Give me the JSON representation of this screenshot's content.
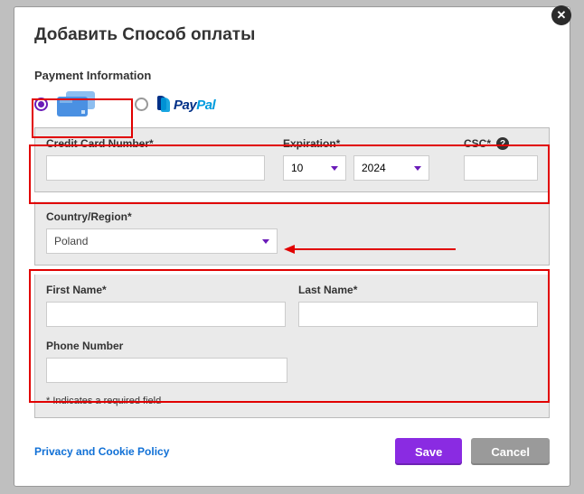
{
  "modal": {
    "title": "Добавить Способ оплаты",
    "close_glyph": "✕"
  },
  "payment": {
    "section_title": "Payment Information",
    "card_selected": true,
    "paypal_text_a": "Pay",
    "paypal_text_b": "Pal"
  },
  "card": {
    "number_label": "Credit Card Number*",
    "number_value": "",
    "expiration_label": "Expiration*",
    "month": "10",
    "year": "2024",
    "csc_label": "CSC*",
    "csc_value": "",
    "help_glyph": "?"
  },
  "country": {
    "label": "Country/Region*",
    "value": "Poland"
  },
  "name": {
    "first_label": "First Name*",
    "first_value": "",
    "last_label": "Last Name*",
    "last_value": "",
    "phone_label": "Phone Number",
    "phone_value": "",
    "required_note": "* Indicates a required field"
  },
  "footer": {
    "policy": "Privacy and Cookie Policy",
    "save": "Save",
    "cancel": "Cancel"
  },
  "colors": {
    "accent": "#8a2be2",
    "annotation": "#e10000"
  }
}
